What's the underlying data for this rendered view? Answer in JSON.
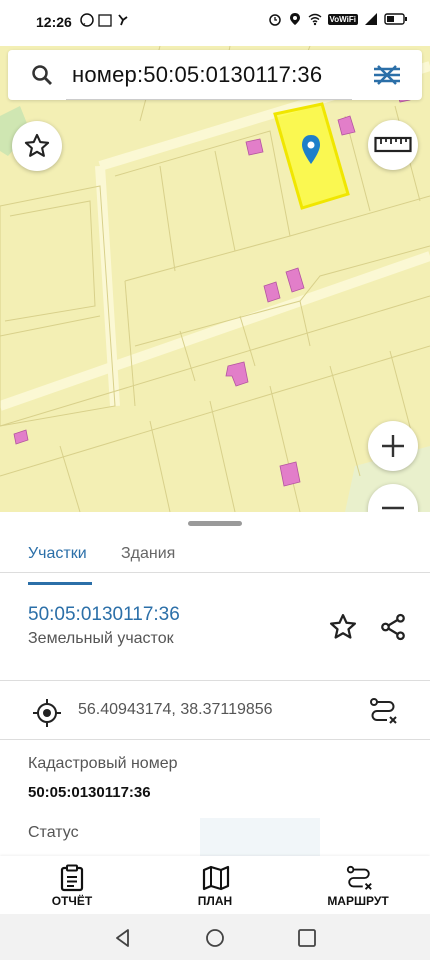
{
  "status_bar": {
    "time": "12:26",
    "calendar_day": "31",
    "volte": "VoWiFi",
    "icons": [
      "whatsapp-icon",
      "calendar-icon",
      "missed-call-icon",
      "alarm-icon",
      "location-icon",
      "wifi-icon",
      "signal-icon",
      "battery-icon"
    ]
  },
  "search": {
    "query": "номер:50:05:0130117:36"
  },
  "map": {
    "background_color": "#f3efb4",
    "selected_parcel_color": "#ffff00",
    "building_color": "#e074c8",
    "marker_color": "#1e7fc9"
  },
  "tabs": [
    {
      "label": "Участки",
      "active": true
    },
    {
      "label": "Здания",
      "active": false
    }
  ],
  "parcel": {
    "number": "50:05:0130117:36",
    "type": "Земельный участок"
  },
  "coordinates": "56.40943174, 38.37119856",
  "details": [
    {
      "label": "Кадастровый номер",
      "value": "50:05:0130117:36"
    },
    {
      "label": "Статус",
      "value": ""
    }
  ],
  "bottom_nav": [
    {
      "label": "ОТЧЁТ",
      "icon": "report-icon"
    },
    {
      "label": "ПЛАН",
      "icon": "map-plan-icon"
    },
    {
      "label": "МАРШРУТ",
      "icon": "route-icon"
    }
  ],
  "colors": {
    "accent": "#2b6fa8"
  }
}
